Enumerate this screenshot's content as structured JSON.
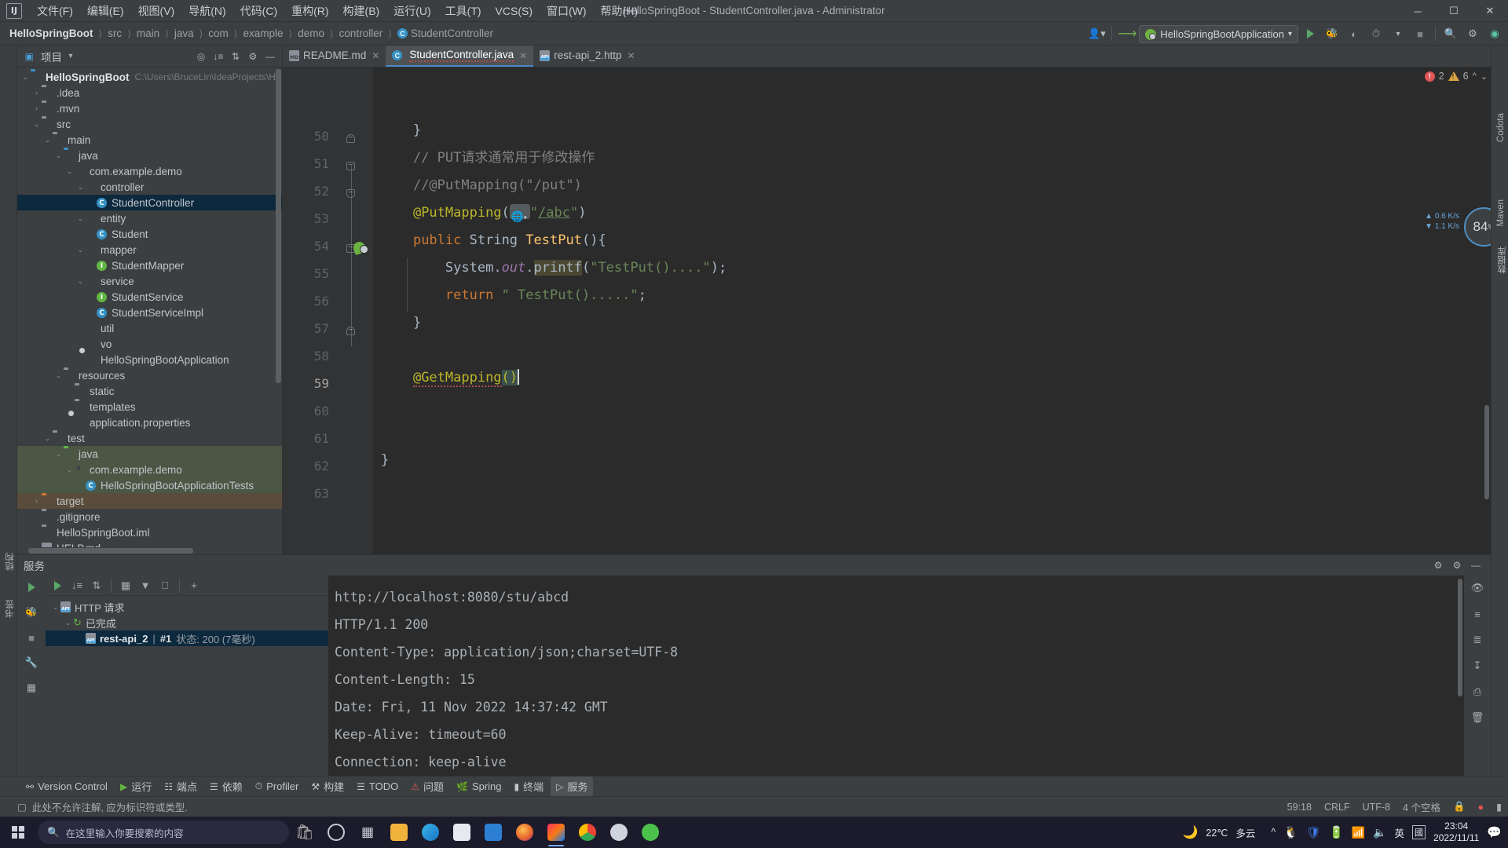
{
  "window": {
    "title": "HelloSpringBoot - StudentController.java - Administrator",
    "minimize": "─",
    "maximize": "☐",
    "close": "✕"
  },
  "menubar": {
    "items": [
      {
        "label": "文件(F)"
      },
      {
        "label": "编辑(E)"
      },
      {
        "label": "视图(V)"
      },
      {
        "label": "导航(N)"
      },
      {
        "label": "代码(C)"
      },
      {
        "label": "重构(R)"
      },
      {
        "label": "构建(B)"
      },
      {
        "label": "运行(U)"
      },
      {
        "label": "工具(T)"
      },
      {
        "label": "VCS(S)"
      },
      {
        "label": "窗口(W)"
      },
      {
        "label": "帮助(H)"
      }
    ]
  },
  "navbar": {
    "crumbs": [
      "HelloSpringBoot",
      "src",
      "main",
      "java",
      "com",
      "example",
      "demo",
      "controller"
    ],
    "final_crumb": "StudentController",
    "final_crumb_icon": "C",
    "run_config": "HelloSpringBootApplication",
    "icons": [
      "user-icon",
      "updates-icon",
      "run-icon",
      "debug-icon",
      "run-coverage-icon",
      "profile-icon",
      "stop-icon",
      "search-icon",
      "settings-icon",
      "ai-icon"
    ]
  },
  "project_panel": {
    "title": "项目",
    "header_icons": [
      "locate-icon",
      "collapse-icon",
      "expand-icon",
      "settings-icon",
      "hide-icon"
    ],
    "tree": [
      {
        "label": "HelloSpringBoot",
        "hint": "C:\\Users\\BruceLin\\IdeaProjects\\H",
        "indent": 0,
        "arrow": "⌄",
        "icon": "module-folder",
        "bold": true
      },
      {
        "label": ".idea",
        "indent": 1,
        "arrow": "›",
        "icon": "folder"
      },
      {
        "label": ".mvn",
        "indent": 1,
        "arrow": "›",
        "icon": "folder"
      },
      {
        "label": "src",
        "indent": 1,
        "arrow": "⌄",
        "icon": "folder"
      },
      {
        "label": "main",
        "indent": 2,
        "arrow": "⌄",
        "icon": "folder"
      },
      {
        "label": "java",
        "indent": 3,
        "arrow": "⌄",
        "icon": "folder-blue"
      },
      {
        "label": "com.example.demo",
        "indent": 4,
        "arrow": "⌄",
        "icon": "package"
      },
      {
        "label": "controller",
        "indent": 5,
        "arrow": "⌄",
        "icon": "package"
      },
      {
        "label": "StudentController",
        "indent": 6,
        "arrow": "",
        "icon": "class",
        "selected": true
      },
      {
        "label": "entity",
        "indent": 5,
        "arrow": "⌄",
        "icon": "package"
      },
      {
        "label": "Student",
        "indent": 6,
        "arrow": "",
        "icon": "class"
      },
      {
        "label": "mapper",
        "indent": 5,
        "arrow": "⌄",
        "icon": "package"
      },
      {
        "label": "StudentMapper",
        "indent": 6,
        "arrow": "",
        "icon": "interface"
      },
      {
        "label": "service",
        "indent": 5,
        "arrow": "⌄",
        "icon": "package"
      },
      {
        "label": "StudentService",
        "indent": 6,
        "arrow": "",
        "icon": "interface"
      },
      {
        "label": "StudentServiceImpl",
        "indent": 6,
        "arrow": "",
        "icon": "class"
      },
      {
        "label": "util",
        "indent": 5,
        "arrow": "",
        "icon": "package"
      },
      {
        "label": "vo",
        "indent": 5,
        "arrow": "",
        "icon": "package"
      },
      {
        "label": "HelloSpringBootApplication",
        "indent": 5,
        "arrow": "",
        "icon": "spring"
      },
      {
        "label": "resources",
        "indent": 3,
        "arrow": "⌄",
        "icon": "resources-folder"
      },
      {
        "label": "static",
        "indent": 4,
        "arrow": "",
        "icon": "folder"
      },
      {
        "label": "templates",
        "indent": 4,
        "arrow": "",
        "icon": "folder"
      },
      {
        "label": "application.properties",
        "indent": 4,
        "arrow": "",
        "icon": "spring"
      },
      {
        "label": "test",
        "indent": 2,
        "arrow": "⌄",
        "icon": "folder"
      },
      {
        "label": "java",
        "indent": 3,
        "arrow": "⌄",
        "icon": "folder-green",
        "green": true
      },
      {
        "label": "com.example.demo",
        "indent": 4,
        "arrow": "⌄",
        "icon": "package",
        "green": true
      },
      {
        "label": "HelloSpringBootApplicationTests",
        "indent": 5,
        "arrow": "",
        "icon": "test-class",
        "green": true
      },
      {
        "label": "target",
        "indent": 1,
        "arrow": "›",
        "icon": "folder-orange",
        "orange": true
      },
      {
        "label": ".gitignore",
        "indent": 1,
        "arrow": "",
        "icon": "gitignore"
      },
      {
        "label": "HelloSpringBoot.iml",
        "indent": 1,
        "arrow": "",
        "icon": "iml"
      },
      {
        "label": "HELP.md",
        "indent": 1,
        "arrow": "",
        "icon": "md"
      }
    ]
  },
  "left_strip": {
    "tabs": [
      "结构",
      "书签"
    ]
  },
  "right_strip": {
    "tabs": [
      "Maven",
      "数据库",
      "Codota"
    ]
  },
  "editor": {
    "tabs": [
      {
        "label": "README.md",
        "icon": "md-icon",
        "active": false
      },
      {
        "label": "StudentController.java",
        "icon": "class-icon",
        "active": true
      },
      {
        "label": "rest-api_2.http",
        "icon": "http-icon",
        "active": false
      }
    ],
    "inspection": {
      "errors": "2",
      "warnings": "6"
    },
    "cpu_meter": {
      "value": "84",
      "unit": "%"
    },
    "net": {
      "upload": "0.6 K/s",
      "download": "1.1 K/s"
    },
    "first_line": 50,
    "current_line": 59,
    "lines": [
      {
        "n": 50,
        "text": "    }"
      },
      {
        "n": 51,
        "text": "    // PUT请求通常用于修改操作"
      },
      {
        "n": 52,
        "text": "    //@PutMapping(\"/put\")"
      },
      {
        "n": 53,
        "text": "    @PutMapping(\"/abc\")"
      },
      {
        "n": 54,
        "text": "    public String TestPut(){"
      },
      {
        "n": 55,
        "text": "        System.out.printf(\"TestPut()....\");"
      },
      {
        "n": 56,
        "text": "        return \" TestPut().....\";"
      },
      {
        "n": 57,
        "text": "    }"
      },
      {
        "n": 58,
        "text": ""
      },
      {
        "n": 59,
        "text": "    @GetMapping()"
      },
      {
        "n": 60,
        "text": ""
      },
      {
        "n": 61,
        "text": ""
      },
      {
        "n": 62,
        "text": "}"
      },
      {
        "n": 63,
        "text": ""
      }
    ],
    "tokens": {
      "comment_51": "// PUT请求通常用于修改操作",
      "comment_52": "//@PutMapping(\"/put\")",
      "ann_putmapping": "@PutMapping",
      "path_abc": "\"/abc\"",
      "kw_public": "public",
      "type_String": "String",
      "mth_TestPut": "TestPut",
      "id_System": "System",
      "fld_out": "out",
      "mth_printf": "printf",
      "str_printf": "\"TestPut()....\"",
      "kw_return": "return",
      "str_return": "\" TestPut().....\"",
      "ann_getmapping": "@GetMapping"
    }
  },
  "services": {
    "title": "服务",
    "header_icons": [
      "settings-icon",
      "gear-icon",
      "hide-icon"
    ],
    "gutter_icons": [
      "run-icon",
      "debug-icon",
      "stop-icon",
      "wrench-icon",
      "layout-icon"
    ],
    "toolbar_icons": [
      "run-icon",
      "expand-all-icon",
      "collapse-all-icon",
      "group-icon",
      "filter-icon",
      "open-icon",
      "add-icon"
    ],
    "tree": [
      {
        "label": "HTTP 请求",
        "indent": 0,
        "arrow": "⌄",
        "icon": "api"
      },
      {
        "label": "已完成",
        "indent": 1,
        "arrow": "⌄",
        "icon": "rerun"
      },
      {
        "label": "rest-api_2",
        "suffix_sep": "|",
        "suffix_num": "#1",
        "suffix": "状态: 200 (7毫秒)",
        "indent": 2,
        "arrow": "",
        "icon": "api",
        "selected": true
      }
    ],
    "response": [
      "http://localhost:8080/stu/abcd",
      "",
      "HTTP/1.1 200",
      "Content-Type: application/json;charset=UTF-8",
      "Content-Length: 15",
      "Date: Fri, 11 Nov 2022 14:37:42 GMT",
      "Keep-Alive: timeout=60",
      "Connection: keep-alive"
    ],
    "right_icons": [
      "eye-icon",
      "wrap-icon",
      "soft-wrap-icon",
      "scroll-end-icon",
      "print-icon",
      "clear-icon"
    ]
  },
  "toolwindow_bar": {
    "items": [
      {
        "label": "Version Control",
        "icon": "branch-icon",
        "active": false
      },
      {
        "label": "运行",
        "icon": "run-icon",
        "active": false
      },
      {
        "label": "端点",
        "icon": "endpoints-icon",
        "active": false
      },
      {
        "label": "依赖",
        "icon": "dependencies-icon",
        "active": false
      },
      {
        "label": "Profiler",
        "icon": "profiler-icon",
        "active": false
      },
      {
        "label": "构建",
        "icon": "build-icon",
        "active": false
      },
      {
        "label": "TODO",
        "icon": "todo-icon",
        "active": false
      },
      {
        "label": "问题",
        "icon": "problems-icon",
        "active": false
      },
      {
        "label": "Spring",
        "icon": "spring-icon",
        "active": false
      },
      {
        "label": "终端",
        "icon": "terminal-icon",
        "active": false
      },
      {
        "label": "服务",
        "icon": "services-icon",
        "active": true
      }
    ]
  },
  "statusbar": {
    "message": "此处不允许注解, 应为标识符或类型.",
    "caret": "59:18",
    "line_sep": "CRLF",
    "encoding": "UTF-8",
    "indent": "4 个空格",
    "icons": [
      "lock-icon",
      "inspection-icon",
      "terminal-icon"
    ]
  },
  "taskbar": {
    "search_placeholder": "在这里输入你要搜索的内容",
    "apps": [
      "cortana-icon",
      "taskview-icon",
      "explorer-icon",
      "edge-icon",
      "store-icon",
      "mail-icon",
      "firefox-icon",
      "idea-icon",
      "chrome-icon",
      "paint-icon",
      "wechat-icon"
    ],
    "weather": {
      "temp": "22℃",
      "desc": "多云"
    },
    "tray_icons": [
      "chevron-up-icon",
      "qq-icon",
      "security-icon",
      "battery-icon",
      "wifi-icon",
      "volume-icon",
      "ime-icon",
      "ime-mode-icon"
    ],
    "ime": "英",
    "clock_time": "23:04",
    "clock_date": "2022/11/11",
    "notification": "notification-icon"
  },
  "colors": {
    "bg": "#2b2b2b",
    "panel": "#3c3f41",
    "accent": "#4a88c7",
    "selection": "#0d293e",
    "keyword": "#cc7832",
    "string": "#6a8759",
    "annotation": "#bbb529",
    "comment": "#808080",
    "method": "#ffc66d",
    "field": "#9876aa",
    "green": "#62b543",
    "error": "#e05555"
  }
}
